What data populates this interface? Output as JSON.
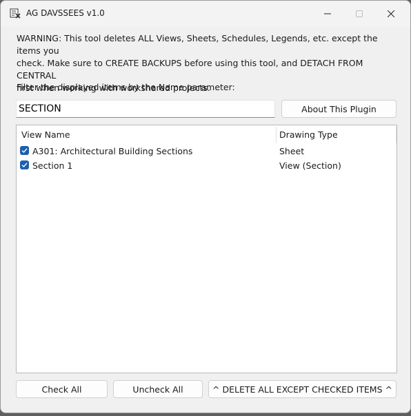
{
  "window": {
    "title": "AG DAVSSEES v1.0",
    "controls": {
      "minimize": "minimize-icon",
      "maximize": "maximize-icon",
      "close": "close-icon"
    }
  },
  "warning": {
    "line1": "WARNING: This tool deletes ALL Views, Sheets, Schedules, Legends, etc. except the items you",
    "line2": "check. Make sure to CREATE BACKUPS before using this tool, and DETACH FROM CENTRAL",
    "line3": "first when working with workshared projects."
  },
  "filter": {
    "label": "Filter the displayed items by the Name parameter:",
    "value": "SECTION"
  },
  "about_button": "About This Plugin",
  "list": {
    "columns": [
      "View Name",
      "Drawing Type"
    ],
    "rows": [
      {
        "checked": true,
        "name": "A301: Architectural Building Sections",
        "type": "Sheet"
      },
      {
        "checked": true,
        "name": "Section 1",
        "type": "View (Section)"
      }
    ]
  },
  "footer": {
    "check_all": "Check All",
    "uncheck_all": "Uncheck All",
    "delete": "^ DELETE ALL EXCEPT CHECKED ITEMS ^"
  },
  "colors": {
    "checkbox": "#1f5fad",
    "window_bg": "#f0f0f0"
  }
}
